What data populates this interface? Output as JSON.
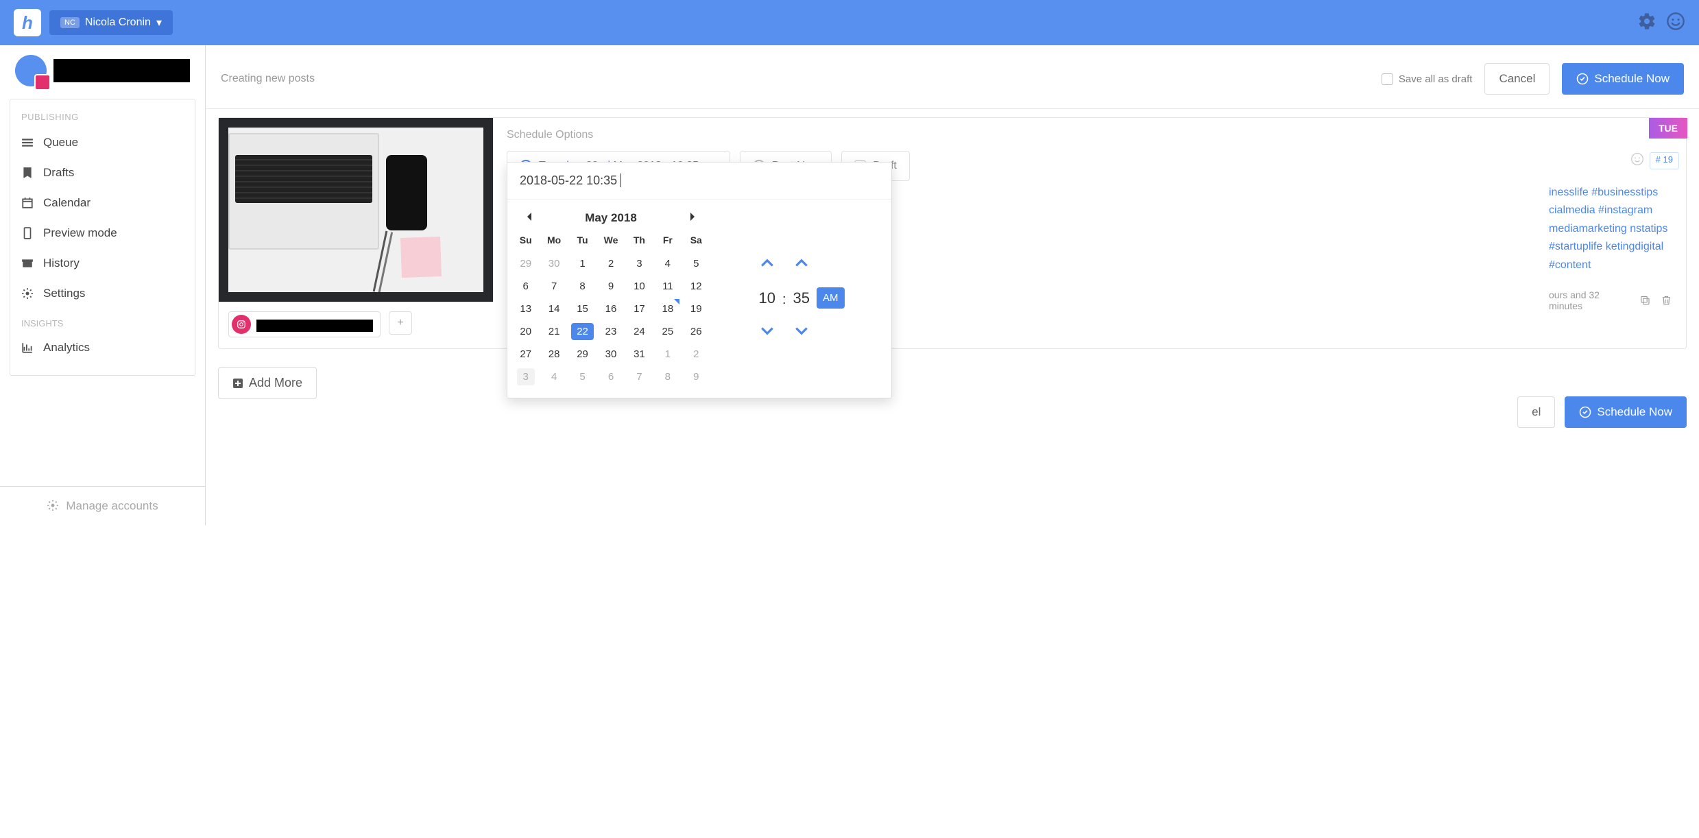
{
  "topbar": {
    "user_initials": "NC",
    "user_name": "Nicola Cronin"
  },
  "sidebar": {
    "publishing_heading": "PUBLISHING",
    "items": [
      {
        "label": "Queue"
      },
      {
        "label": "Drafts"
      },
      {
        "label": "Calendar"
      },
      {
        "label": "Preview mode"
      },
      {
        "label": "History"
      },
      {
        "label": "Settings"
      }
    ],
    "insights_heading": "INSIGHTS",
    "analytics_label": "Analytics",
    "manage_accounts": "Manage accounts"
  },
  "header": {
    "title": "Creating new posts",
    "save_draft": "Save all as draft",
    "cancel": "Cancel",
    "schedule_now": "Schedule Now"
  },
  "post": {
    "day_tag": "TUE",
    "schedule_title": "Schedule Options",
    "scheduled_label": "Tuesday, 22nd May 2018 - 10:35 am",
    "post_now": "Post Now",
    "draft": "Draft",
    "hashtag_count": "# 19",
    "hashtags": "inesslife #businesstips cialmedia #instagram mediamarketing nstatips #startuplife ketingdigital #content",
    "time_estimate": "ours and 32 minutes"
  },
  "datepicker": {
    "input_value": "2018-05-22 10:35",
    "month_label": "May 2018",
    "dow": [
      "Su",
      "Mo",
      "Tu",
      "We",
      "Th",
      "Fr",
      "Sa"
    ],
    "weeks": [
      [
        {
          "d": "29",
          "m": true
        },
        {
          "d": "30",
          "m": true
        },
        {
          "d": "1"
        },
        {
          "d": "2"
        },
        {
          "d": "3"
        },
        {
          "d": "4"
        },
        {
          "d": "5"
        }
      ],
      [
        {
          "d": "6"
        },
        {
          "d": "7"
        },
        {
          "d": "8"
        },
        {
          "d": "9"
        },
        {
          "d": "10"
        },
        {
          "d": "11"
        },
        {
          "d": "12"
        }
      ],
      [
        {
          "d": "13"
        },
        {
          "d": "14"
        },
        {
          "d": "15"
        },
        {
          "d": "16"
        },
        {
          "d": "17"
        },
        {
          "d": "18",
          "today": true
        },
        {
          "d": "19"
        }
      ],
      [
        {
          "d": "20"
        },
        {
          "d": "21"
        },
        {
          "d": "22",
          "sel": true
        },
        {
          "d": "23"
        },
        {
          "d": "24"
        },
        {
          "d": "25"
        },
        {
          "d": "26"
        }
      ],
      [
        {
          "d": "27"
        },
        {
          "d": "28"
        },
        {
          "d": "29"
        },
        {
          "d": "30"
        },
        {
          "d": "31"
        },
        {
          "d": "1",
          "m": true
        },
        {
          "d": "2",
          "m": true
        }
      ],
      [
        {
          "d": "3",
          "m": true,
          "hov": true
        },
        {
          "d": "4",
          "m": true
        },
        {
          "d": "5",
          "m": true
        },
        {
          "d": "6",
          "m": true
        },
        {
          "d": "7",
          "m": true
        },
        {
          "d": "8",
          "m": true
        },
        {
          "d": "9",
          "m": true
        }
      ]
    ],
    "hour": "10",
    "minute": "35",
    "ampm": "AM"
  },
  "add_more": "Add More",
  "footer": {
    "cancel_partial": "el",
    "schedule_now": "Schedule Now"
  }
}
